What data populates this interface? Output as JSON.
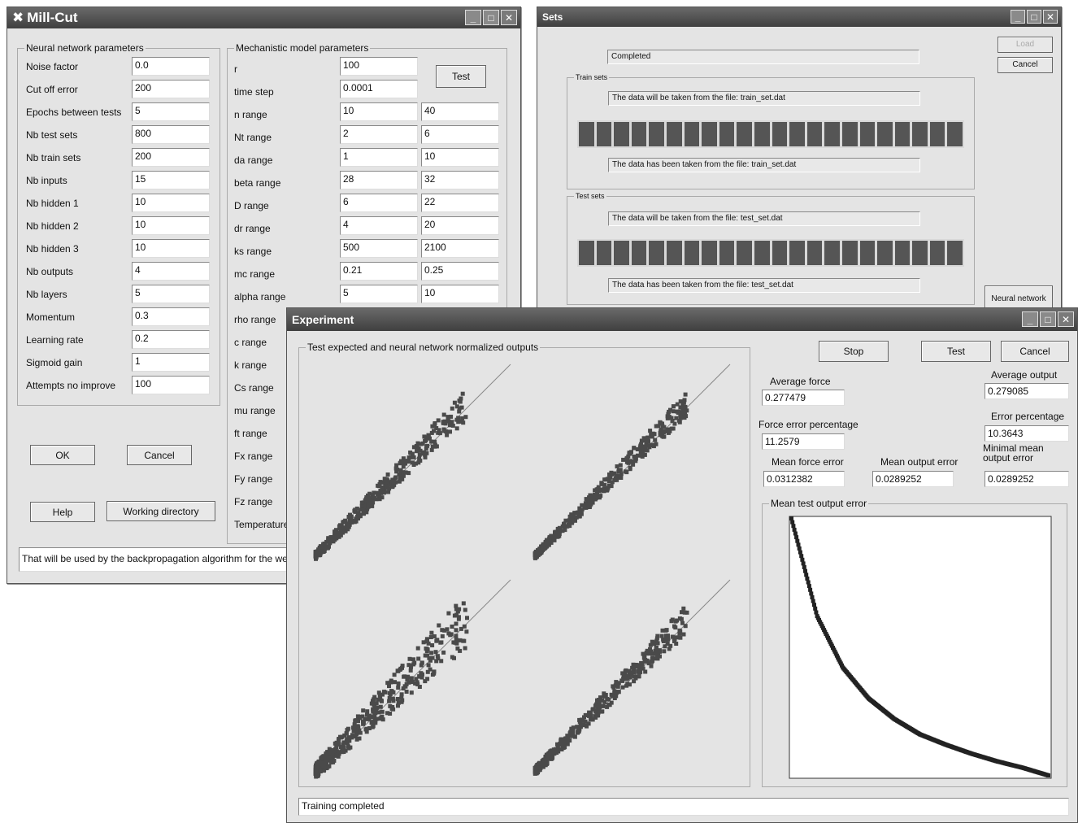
{
  "millcut": {
    "title": "Mill-Cut",
    "nn_group_label": "Neural network parameters",
    "nn_params": [
      {
        "label": "Noise factor",
        "value": "0.0"
      },
      {
        "label": "Cut off error",
        "value": "200"
      },
      {
        "label": "Epochs between tests",
        "value": "5"
      },
      {
        "label": "Nb test sets",
        "value": "800"
      },
      {
        "label": "Nb train sets",
        "value": "200"
      },
      {
        "label": "Nb inputs",
        "value": "15"
      },
      {
        "label": "Nb hidden 1",
        "value": "10"
      },
      {
        "label": "Nb hidden 2",
        "value": "10"
      },
      {
        "label": "Nb hidden 3",
        "value": "10"
      },
      {
        "label": "Nb outputs",
        "value": "4"
      },
      {
        "label": "Nb layers",
        "value": "5"
      },
      {
        "label": "Momentum",
        "value": "0.3"
      },
      {
        "label": "Learning rate",
        "value": "0.2"
      },
      {
        "label": "Sigmoid gain",
        "value": "1"
      },
      {
        "label": "Attempts no improve",
        "value": "100"
      }
    ],
    "mm_group_label": "Mechanistic model parameters",
    "mm_params": [
      {
        "label": "r",
        "min": "100",
        "max": null
      },
      {
        "label": "time step",
        "min": "0.0001",
        "max": null
      },
      {
        "label": "n range",
        "min": "10",
        "max": "40"
      },
      {
        "label": "Nt range",
        "min": "2",
        "max": "6"
      },
      {
        "label": "da range",
        "min": "1",
        "max": "10"
      },
      {
        "label": "beta range",
        "min": "28",
        "max": "32"
      },
      {
        "label": "D range",
        "min": "6",
        "max": "22"
      },
      {
        "label": "dr range",
        "min": "4",
        "max": "20"
      },
      {
        "label": "ks range",
        "min": "500",
        "max": "2100"
      },
      {
        "label": "mc range",
        "min": "0.21",
        "max": "0.25"
      },
      {
        "label": "alpha range",
        "min": "5",
        "max": "10"
      },
      {
        "label": "rho range",
        "min": null,
        "max": null
      },
      {
        "label": "c range",
        "min": null,
        "max": null
      },
      {
        "label": "k range",
        "min": null,
        "max": null
      },
      {
        "label": "Cs range",
        "min": null,
        "max": null
      },
      {
        "label": "mu range",
        "min": null,
        "max": null
      },
      {
        "label": "ft range",
        "min": null,
        "max": null
      },
      {
        "label": "Fx range",
        "min": null,
        "max": null
      },
      {
        "label": "Fy range",
        "min": null,
        "max": null
      },
      {
        "label": "Fz range",
        "min": null,
        "max": null
      },
      {
        "label": "Temperature",
        "min": null,
        "max": null
      }
    ],
    "test_label": "Test",
    "ok_label": "OK",
    "cancel_label": "Cancel",
    "help_label": "Help",
    "working_dir_label": "Working directory",
    "status_text": "That will be used by the backpropagation algorithm for the weig"
  },
  "sets": {
    "title": "Sets",
    "completed_text": "Completed",
    "load_label": "Load",
    "cancel_label": "Cancel",
    "train_group_label": "Train sets",
    "train_source_text": "The data will be taken from the file: train_set.dat",
    "train_done_text": "The data has been taken from the file: train_set.dat",
    "test_group_label": "Test sets",
    "test_source_text": "The data will be taken from the file: test_set.dat",
    "test_done_text": "The data has been taken from the file: test_set.dat",
    "neural_network_label": "Neural network",
    "train_progress": 1.0,
    "test_progress": 1.0
  },
  "experiment": {
    "title": "Experiment",
    "plots_group_label": "Test expected and neural network normalized outputs",
    "stop_label": "Stop",
    "test_label": "Test",
    "cancel_label": "Cancel",
    "average_force_label": "Average force",
    "average_force_value": "0.277479",
    "average_output_label": "Average output",
    "average_output_value": "0.279085",
    "force_error_pct_label": "Force error percentage",
    "force_error_pct_value": "11.2579",
    "error_pct_label": "Error percentage",
    "error_pct_value": "10.3643",
    "mean_force_error_label": "Mean force error",
    "mean_force_error_value": "0.0312382",
    "mean_output_error_label": "Mean output error",
    "mean_output_error_value": "0.0289252",
    "min_mean_output_error_label": "Minimal mean output error",
    "min_mean_output_error_value": "0.0289252",
    "error_group_label": "Mean test output error",
    "status_text": "Training completed"
  },
  "chart_data": [
    {
      "type": "scatter",
      "title": "",
      "series": [
        {
          "x": [
            0.05,
            0.15,
            0.25,
            0.35,
            0.45,
            0.55,
            0.65,
            0.75
          ],
          "y": [
            0.06,
            0.18,
            0.3,
            0.42,
            0.55,
            0.66,
            0.76,
            0.84
          ]
        }
      ]
    },
    {
      "type": "scatter",
      "title": "",
      "series": [
        {
          "x": [
            0.05,
            0.15,
            0.25,
            0.35,
            0.45,
            0.55,
            0.65,
            0.75
          ],
          "y": [
            0.05,
            0.14,
            0.24,
            0.36,
            0.47,
            0.58,
            0.7,
            0.8
          ]
        }
      ]
    },
    {
      "type": "scatter",
      "title": "",
      "series": [
        {
          "x": [
            0.02,
            0.1,
            0.2,
            0.3,
            0.4,
            0.5,
            0.6,
            0.7
          ],
          "y": [
            0.05,
            0.14,
            0.25,
            0.4,
            0.55,
            0.68,
            0.78,
            0.88
          ]
        }
      ]
    },
    {
      "type": "scatter",
      "title": "",
      "series": [
        {
          "x": [
            0.05,
            0.15,
            0.25,
            0.35,
            0.45,
            0.55,
            0.65,
            0.75
          ],
          "y": [
            0.04,
            0.12,
            0.22,
            0.34,
            0.45,
            0.55,
            0.65,
            0.75
          ]
        }
      ]
    },
    {
      "type": "line",
      "title": "Mean test output error",
      "series": [
        {
          "x": [
            0,
            0.1,
            0.2,
            0.3,
            0.4,
            0.5,
            0.6,
            0.7,
            0.8,
            0.9,
            1.0
          ],
          "y": [
            1.0,
            0.62,
            0.42,
            0.3,
            0.22,
            0.16,
            0.12,
            0.085,
            0.055,
            0.03,
            0.0
          ]
        }
      ]
    }
  ]
}
